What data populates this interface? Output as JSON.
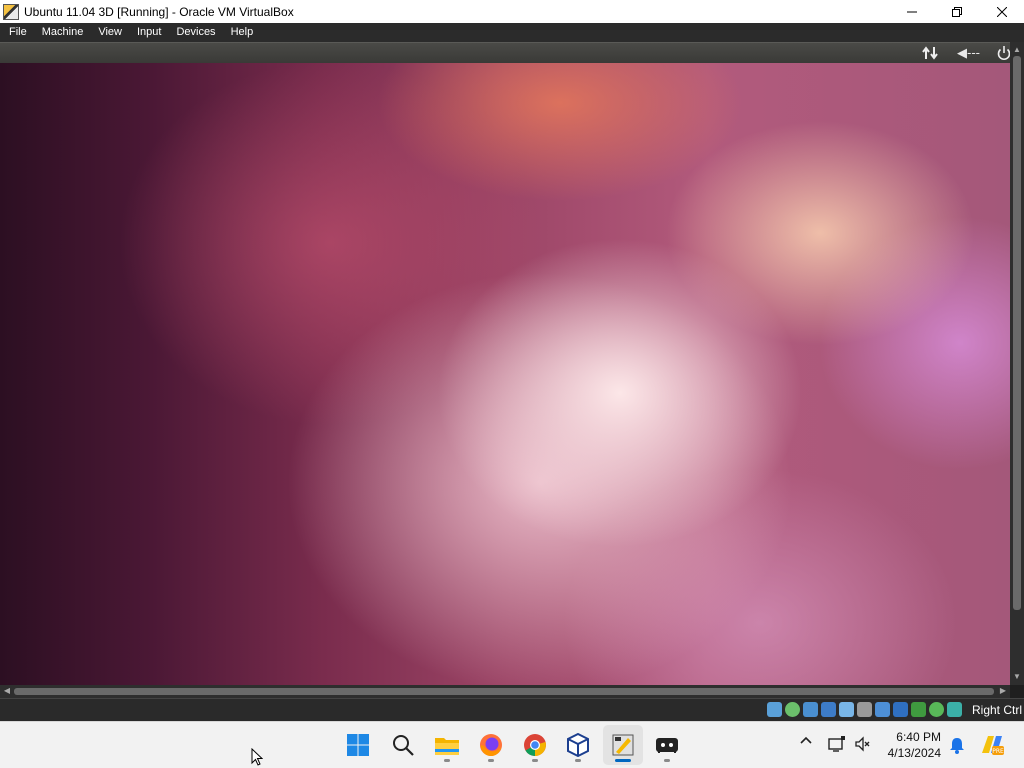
{
  "window": {
    "title": "Ubuntu 11.04 3D [Running] - Oracle VM VirtualBox",
    "controls": [
      "minimize-icon",
      "maximize-icon",
      "close-icon"
    ]
  },
  "menu": {
    "items": [
      "File",
      "Machine",
      "View",
      "Input",
      "Devices",
      "Help"
    ]
  },
  "guest_panel": {
    "icons": [
      "network-arrows-icon",
      "volume-muted-icon",
      "power-icon"
    ],
    "volume_text": "◀---"
  },
  "statusbar": {
    "icons": [
      "hard-disk-icon",
      "optical-disk-icon",
      "audio-icon",
      "network-icon",
      "usb-icon",
      "shared-folders-icon",
      "display-icon",
      "video-capture-icon",
      "recording-icon",
      "mouse-integration-icon",
      "keyboard-icon"
    ],
    "host_key": "Right Ctrl"
  },
  "taskbar": {
    "apps": [
      "start-icon",
      "search-icon",
      "file-explorer-icon",
      "firefox-icon",
      "chrome-icon",
      "virtualbox-manager-icon",
      "virtualbox-vm-icon",
      "terminal-icon"
    ],
    "active_app": "virtualbox-vm-icon",
    "tray_icons": [
      "show-hidden-icons-chevron",
      "network-display-icon",
      "volume-muted-icon",
      "notifications-bell-icon",
      "copilot-icon"
    ],
    "clock": {
      "time": "6:40 PM",
      "date": "4/13/2024"
    }
  },
  "colors": {
    "titlebar_bg": "#ffffff",
    "menubar_bg": "#2b2b2b",
    "statusbar_bg": "#2a2a2a",
    "taskbar_bg": "#f2f2f2",
    "accent": "#0067c0"
  }
}
